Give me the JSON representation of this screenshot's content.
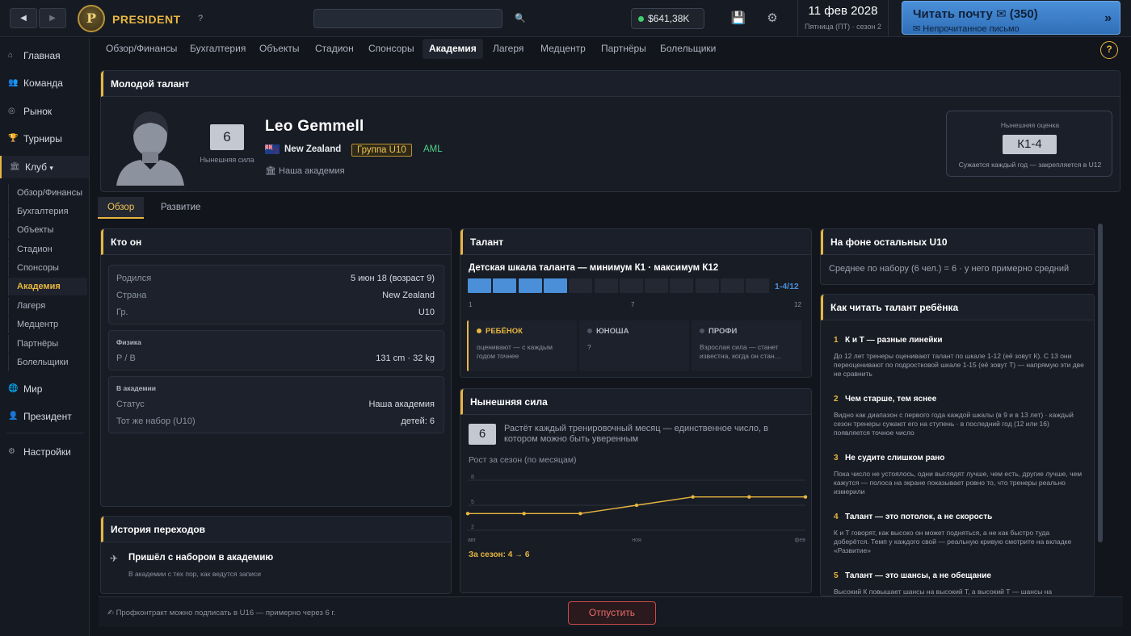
{
  "topbar": {
    "back": "◀",
    "forward": "▶",
    "logo_letter": "P",
    "brand": "PRESIDENT",
    "help": "?",
    "search_placeholder": "",
    "search_icon": "🔍",
    "money": "$641,38K",
    "save_icon": "💾",
    "settings_icon": "⚙",
    "date": "11 фев 2028",
    "date_sub": "Пятница (ПТ) · сезон 2",
    "mail_label": "Читать почту ✉ (350)",
    "mail_sub": "✉ Непрочитанное письмо",
    "mail_arrow": "»",
    "accent": "#e8b640",
    "mail_color": "#4a8fd8"
  },
  "sidebar": {
    "items": [
      {
        "label": "Главная",
        "icon": "⌂"
      },
      {
        "label": "Команда",
        "icon": "👥"
      },
      {
        "label": "Рынок",
        "icon": "◎"
      },
      {
        "label": "Турниры",
        "icon": "🏆"
      },
      {
        "label": "Клуб",
        "icon": "🏛",
        "caret": "▾"
      },
      {
        "label": "Мир",
        "icon": "🌐"
      },
      {
        "label": "Президент",
        "icon": "👤"
      },
      {
        "label": "Настройки",
        "icon": "⚙"
      }
    ],
    "club_subitems": [
      "Обзор/Финансы",
      "Бухгалтерия",
      "Объекты",
      "Стадион",
      "Спонсоры",
      "Академия",
      "Лагеря",
      "Медцентр",
      "Партнёры",
      "Болельщики"
    ]
  },
  "subnav": {
    "tabs": [
      "Обзор/Финансы",
      "Бухгалтерия",
      "Объекты",
      "Стадион",
      "Спонсоры",
      "Академия",
      "Лагеря",
      "Медцентр",
      "Партнёры",
      "Болельщики"
    ],
    "help": "?"
  },
  "hero": {
    "title": "Молодой талант",
    "power": "6",
    "power_caption": "Нынешняя сила",
    "name": "Leo Gemmell",
    "country": "New Zealand",
    "group": "Группа U10",
    "aml": "AML",
    "academy": "🏛 Наша академия",
    "rating_caption": "Нынешняя оценка",
    "rating": "К1-4",
    "rating_note": "Сужается каждый год — закрепляется в U12"
  },
  "tabs": [
    "Обзор",
    "Развитие"
  ],
  "who": {
    "title": "Кто он",
    "born_label": "Родился",
    "born_value": "5 июн 18 (возраст 9)",
    "country_label": "Страна",
    "country_value": "New Zealand",
    "group_label": "Гр.",
    "group_value": "U10",
    "physics_title": "Физика",
    "hw_label": "Р / В",
    "hw_value": "131 cm · 32 kg",
    "academy_title": "В академии",
    "status_label": "Статус",
    "status_value": "Наша академия",
    "cohort_label": "Тот же набор (U10)",
    "cohort_value": "детей: 6"
  },
  "history": {
    "title": "История переходов",
    "icon": "✈",
    "event": "Пришёл с набором в академию",
    "desc": "В академии с тех пор, как ведутся записи"
  },
  "talent": {
    "title": "Талант",
    "scale_title": "Детская шкала таланта — минимум К1 · максимум К12",
    "segments_total": 12,
    "range_from": 1,
    "range_to": 4,
    "range_text": "1-4/12",
    "ticks": [
      "1",
      "7",
      "12"
    ],
    "stages": [
      {
        "name": "РЕБЁНОК",
        "desc": "оценивают — с каждым годом точнее",
        "active": true
      },
      {
        "name": "ЮНОША",
        "desc": "?",
        "active": false
      },
      {
        "name": "ПРОФИ",
        "desc": "Взрослая сила — станет известна, когда он стан…",
        "active": false
      }
    ]
  },
  "current": {
    "title": "Нынешняя сила",
    "value": "6",
    "text": "Растёт каждый тренировочный месяц — единственное число, в котором можно быть уверенным",
    "growth_caption": "Рост за сезон (по месяцам)",
    "season": "За сезон: 4 → 6"
  },
  "chart_data": {
    "type": "line",
    "x": [
      "авг",
      "сен",
      "окт",
      "ноя",
      "дек",
      "янв",
      "фев"
    ],
    "x_ticks": [
      "авг",
      "ноя",
      "фев"
    ],
    "values": [
      4,
      4,
      4,
      5,
      6,
      6,
      6
    ],
    "y_ticks": [
      "8",
      "5",
      "2"
    ],
    "ylim": [
      2,
      8
    ],
    "color": "#e8b640"
  },
  "compare": {
    "title_prefix": "На фоне остальных",
    "title_group": "U10",
    "text": "Среднее по набору (6 чел.) = 6 · у него примерно средний"
  },
  "howto": {
    "title": "Как читать талант ребёнка",
    "sections": [
      {
        "num": "1",
        "title": "К и Т — разные линейки",
        "desc": "До 12 лет тренеры оценивают талант по шкале 1-12 (её зовут К). С 13 они переоценивают по подростковой шкале 1-15 (её зовут Т) — напрямую эти две не сравнить"
      },
      {
        "num": "2",
        "title": "Чем старше, тем яснее",
        "desc": "Видно как диапазон с первого года каждой шкалы (в 9 и в 13 лет) · каждый сезон тренеры сужают его на ступень · в последний год (12 или 16) появляется точное число"
      },
      {
        "num": "3",
        "title": "Не судите слишком рано",
        "desc": "Пока число не устоялось, одни выглядят лучше, чем есть, другие лучше, чем кажутся — полоса на экране показывает ровно то, что тренеры реально измерили"
      },
      {
        "num": "4",
        "title": "Талант — это потолок, а не скорость",
        "desc": "К и Т говорят, как высоко он может подняться, а не как быстро туда доберётся. Темп у каждого свой — реальную кривую смотрите на вкладке «Развитие»"
      },
      {
        "num": "5",
        "title": "Талант — это шансы, а не обещание",
        "desc": "Высокий К повышает шансы на высокий Т, а высокий Т — шансы на"
      }
    ]
  },
  "footer": {
    "note": "✍ Профконтракт можно подписать в U16 — примерно через 6 г.",
    "release": "Отпустить"
  }
}
